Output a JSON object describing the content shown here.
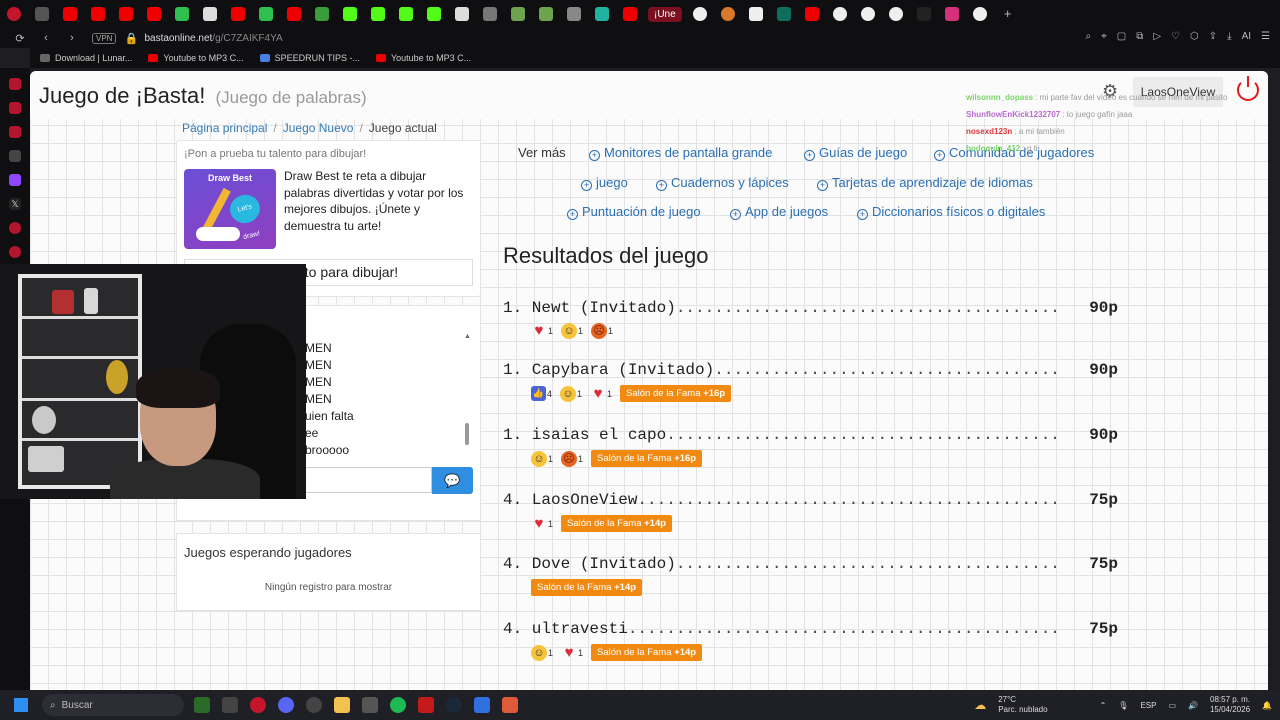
{
  "browser": {
    "active_tab": "¡Une",
    "vpn_label": "VPN",
    "url_host": "bastaonline.net",
    "url_path": "/g/C7ZAIKF4YA",
    "ai_label": "AI",
    "bookmarks": [
      {
        "label": "Download | Lunar...",
        "color": "#666"
      },
      {
        "label": "Youtube to MP3 C...",
        "color": "#e00"
      },
      {
        "label": "SPEEDRUN TIPS -...",
        "color": "#4a7ee0"
      },
      {
        "label": "Youtube to MP3 C...",
        "color": "#e00"
      }
    ]
  },
  "header": {
    "title": "Juego de ¡Basta!",
    "subtitle": "(Juego de palabras)",
    "user_button": "LaosOneView"
  },
  "breadcrumb": {
    "home": "Página principal",
    "new_game": "Juego Nuevo",
    "current": "Juego actual"
  },
  "promo": {
    "heading": "¡Pon a prueba tu talento para dibujar!",
    "image_label": "Draw Best",
    "image_bubble": "Let's draw!",
    "text": "Draw Best te reta a dibujar palabras divertidas y votar por los mejores dibujos. ¡Únete y demuestra tu arte!",
    "button": "tu talento para dibujar!"
  },
  "chat": {
    "lines": [
      "MEN",
      "MEN",
      "MEN",
      "MEN",
      "uien falta",
      "ee",
      "brooooo"
    ],
    "send_icon": "chat-bubble-icon"
  },
  "waiting": {
    "title": "Juegos esperando jugadores",
    "empty": "Ningún registro para mostrar"
  },
  "links": {
    "ver_mas": "Ver más",
    "items": [
      "Monitores de pantalla grande",
      "Guías de juego",
      "Comunidad de jugadores",
      "juego",
      "Cuadernos y lápices",
      "Tarjetas de aprendizaje de idiomas",
      "Puntuación de juego",
      "App de juegos",
      "Diccionarios físicos o digitales"
    ]
  },
  "results": {
    "title": "Resultados del juego",
    "rows": [
      {
        "rank": "1.",
        "name": "Newt (Invitado)",
        "score": "90p",
        "reactions": [
          {
            "type": "heart",
            "count": "1"
          },
          {
            "type": "laugh",
            "count": "1"
          },
          {
            "type": "angry",
            "count": "1"
          }
        ],
        "fame": ""
      },
      {
        "rank": "1.",
        "name": "Capybara (Invitado)",
        "score": "90p",
        "reactions": [
          {
            "type": "like",
            "count": "4"
          },
          {
            "type": "laugh",
            "count": "1"
          },
          {
            "type": "heart",
            "count": "1"
          }
        ],
        "fame": "+16p"
      },
      {
        "rank": "1.",
        "name": "isaias el capo",
        "score": "90p",
        "reactions": [
          {
            "type": "laugh",
            "count": "1"
          },
          {
            "type": "angry",
            "count": "1"
          }
        ],
        "fame": "+16p"
      },
      {
        "rank": "4.",
        "name": "LaosOneView",
        "score": "75p",
        "reactions": [
          {
            "type": "heart",
            "count": "1"
          }
        ],
        "fame": "+14p"
      },
      {
        "rank": "4.",
        "name": "Dove (Invitado)",
        "score": "75p",
        "reactions": [],
        "fame": "+14p"
      },
      {
        "rank": "4.",
        "name": "ultravesti",
        "score": "75p",
        "reactions": [
          {
            "type": "laugh",
            "count": "1"
          },
          {
            "type": "heart",
            "count": "1"
          }
        ],
        "fame": "+14p"
      }
    ],
    "fame_label": "Salón de la Fama"
  },
  "stream_chat": [
    {
      "user": "wilsonnn_dopass",
      "msg": "mi parte fav del vídeo es cuando se ríen de mi pasito",
      "color": "#7bd36a"
    },
    {
      "user": "ShunflowEnKick1232707",
      "msg": "lo juego gafín jaaa",
      "color": "#b86ad0"
    },
    {
      "user": "nosexd123n",
      "msg": "a mi también",
      "color": "#e03838"
    },
    {
      "user": "bodoquin_412",
      "msg": "g ti",
      "color": "#7bd36a"
    }
  ],
  "taskbar": {
    "search": "Buscar",
    "temp": "27°C",
    "weather": "Parc. nublado",
    "lang": "ESP",
    "time": "08:57 p. m.",
    "date": "15/04/2026"
  }
}
